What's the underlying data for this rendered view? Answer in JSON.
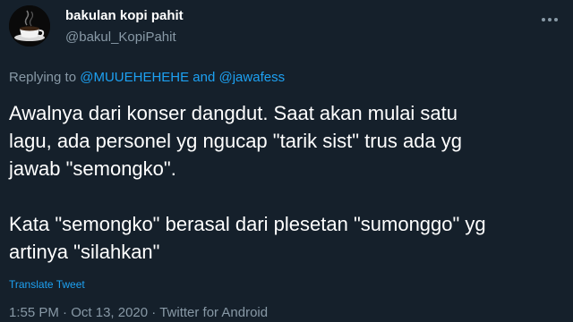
{
  "user": {
    "display_name": "bakulan kopi pahit",
    "handle": "@bakul_KopiPahit",
    "avatar_icon": "coffee-cup-icon"
  },
  "menu": {
    "icon": "more-horizontal-icon"
  },
  "reply": {
    "prefix": "Replying to",
    "mention_1": "@MUUEHEHEHE",
    "conjunction": "and",
    "mention_2": "@jawafess"
  },
  "tweet": {
    "lines": [
      "Awalnya dari konser dangdut. Saat akan mulai satu",
      "lagu, ada personel yg ngucap \"tarik sist\" trus ada yg",
      "jawab \"semongko\".",
      "Kata \"semongko\" berasal dari plesetan \"sumonggo\" yg",
      "artinya \"silahkan\""
    ],
    "translate_label": "Translate Tweet"
  },
  "meta": {
    "time": "1:55 PM",
    "separator": "·",
    "date": "Oct 13, 2020",
    "source": "Twitter for Android"
  },
  "colors": {
    "background": "#15202b",
    "accent": "#1da1f2",
    "secondary_text": "#8899a6"
  }
}
